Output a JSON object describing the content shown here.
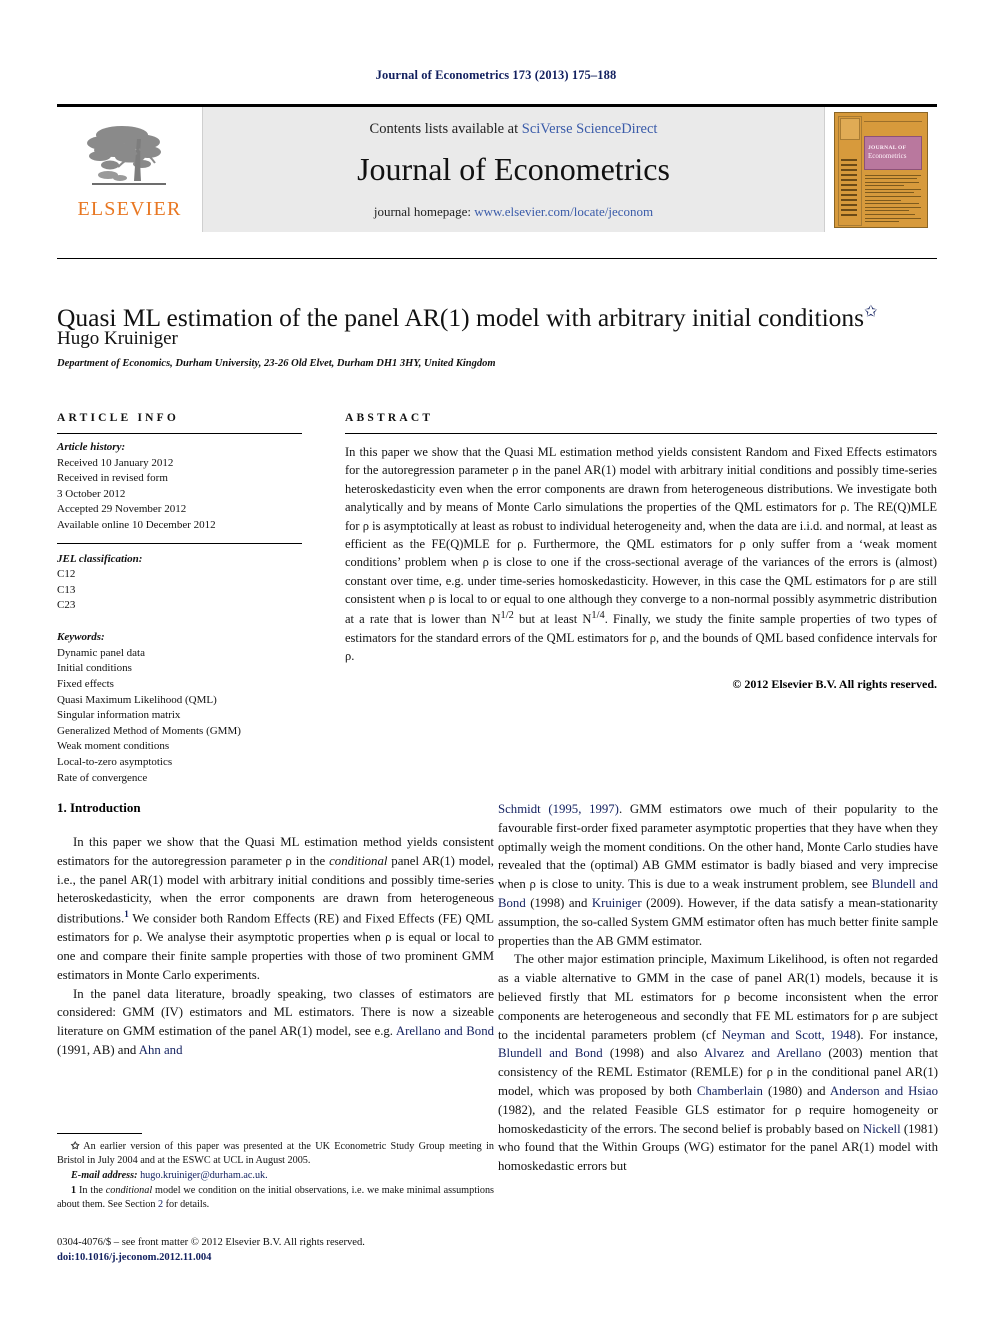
{
  "running_head": "Journal of Econometrics 173 (2013) 175–188",
  "masthead": {
    "publisher_name": "ELSEVIER",
    "contents_prefix": "Contents lists available at ",
    "contents_link": "SciVerse ScienceDirect",
    "journal_name": "Journal of Econometrics",
    "homepage_prefix": "journal homepage: ",
    "homepage_url": "www.elsevier.com/locate/jeconom",
    "cover": {
      "line1": "JOURNAL OF",
      "line2": "Econometrics"
    }
  },
  "article": {
    "title": "Quasi ML estimation of the panel AR(1) model with arbitrary initial conditions",
    "title_footnote_mark": "✩",
    "author": "Hugo Kruiniger",
    "affiliation": "Department of Economics, Durham University, 23-26 Old Elvet, Durham DH1 3HY, United Kingdom"
  },
  "info": {
    "heading": "ARTICLE INFO",
    "history_label": "Article history:",
    "history": [
      "Received 10 January 2012",
      "Received in revised form",
      "3 October 2012",
      "Accepted 29 November 2012",
      "Available online 10 December 2012"
    ],
    "jel_label": "JEL classification:",
    "jel": [
      "C12",
      "C13",
      "C23"
    ],
    "keywords_label": "Keywords:",
    "keywords": [
      "Dynamic panel data",
      "Initial conditions",
      "Fixed effects",
      "Quasi Maximum Likelihood (QML)",
      "Singular information matrix",
      "Generalized Method of Moments (GMM)",
      "Weak moment conditions",
      "Local-to-zero asymptotics",
      "Rate of convergence"
    ]
  },
  "abstract": {
    "heading": "ABSTRACT",
    "text": "In this paper we show that the Quasi ML estimation method yields consistent Random and Fixed Effects estimators for the autoregression parameter ρ in the panel AR(1) model with arbitrary initial conditions and possibly time-series heteroskedasticity even when the error components are drawn from heterogeneous distributions. We investigate both analytically and by means of Monte Carlo simulations the properties of the QML estimators for ρ. The RE(Q)MLE for ρ is asymptotically at least as robust to individual heterogeneity and, when the data are i.i.d. and normal, at least as efficient as the FE(Q)MLE for ρ. Furthermore, the QML estimators for ρ only suffer from a ‘weak moment conditions’ problem when ρ is close to one if the cross-sectional average of the variances of the errors is (almost) constant over time, e.g. under time-series homoskedasticity. However, in this case the QML estimators for ρ are still consistent when ρ is local to or equal to one although they converge to a non-normal possibly asymmetric distribution at a rate that is lower than N",
    "text_sup1": "1/2",
    "text_mid": " but at least N",
    "text_sup2": "1/4",
    "text_end": ". Finally, we study the finite sample properties of two types of estimators for the standard errors of the QML estimators for ρ, and the bounds of QML based confidence intervals for ρ.",
    "copyright": "© 2012 Elsevier B.V. All rights reserved."
  },
  "body": {
    "section_heading": "1.  Introduction",
    "left": {
      "p1_a": "In this paper we show that the Quasi ML estimation method yields consistent estimators for the autoregression parameter ρ in the ",
      "p1_ital": "conditional",
      "p1_b": " panel AR(1) model, i.e., the panel AR(1) model with arbitrary initial conditions and possibly time-series heteroskedasticity, when the error components are drawn from heterogeneous distributions.",
      "p1_fn": "1",
      "p1_c": " We consider both Random Effects (RE) and Fixed Effects (FE) QML estimators for ρ. We analyse their asymptotic properties when ρ is equal or local to one and compare their finite sample properties with those of two prominent GMM estimators in Monte Carlo experiments.",
      "p2_a": "In the panel data literature, broadly speaking, two classes of estimators are considered: GMM (IV) estimators and ML estimators. There is now a sizeable literature on GMM estimation of the panel AR(1) model, see e.g. ",
      "p2_cite1": "Arellano and Bond",
      "p2_b": " (1991, AB) and ",
      "p2_cite2": "Ahn and"
    },
    "right": {
      "p1_cite1": "Schmidt (1995, 1997)",
      "p1_a": ". GMM estimators owe much of their popularity to the favourable first-order fixed parameter asymptotic properties that they have when they optimally weigh the moment conditions. On the other hand, Monte Carlo studies have revealed that the (optimal) AB GMM estimator is badly biased and very imprecise when ρ is close to unity. This is due to a weak instrument problem, see ",
      "p1_cite2": "Blundell and Bond",
      "p1_b": " (1998) and ",
      "p1_cite3": "Kruiniger",
      "p1_c": " (2009). However, if the data satisfy a mean-stationarity assumption, the so-called System GMM estimator often has much better finite sample properties than the AB GMM estimator.",
      "p2_a": "The other major estimation principle, Maximum Likelihood, is often not regarded as a viable alternative to GMM in the case of panel AR(1) models, because it is believed firstly that ML estimators for ρ become inconsistent when the error components are heterogeneous and secondly that FE ML estimators for ρ are subject to the incidental parameters problem (cf ",
      "p2_cite1": "Neyman and Scott, 1948",
      "p2_b": "). For instance, ",
      "p2_cite2": "Blundell and Bond",
      "p2_c": " (1998) and also ",
      "p2_cite3": "Alvarez and Arellano",
      "p2_d": " (2003) mention that consistency of the REML Estimator (REMLE) for ρ in the conditional panel AR(1) model, which was proposed by both ",
      "p2_cite4": "Chamberlain",
      "p2_e": " (1980) and ",
      "p2_cite5": "Anderson and Hsiao",
      "p2_f": " (1982), and the related Feasible GLS estimator for ρ require homogeneity or homoskedasticity of the errors. The second belief is probably based on ",
      "p2_cite6": "Nickell",
      "p2_g": " (1981) who found that the Within Groups (WG) estimator for the panel AR(1) model with homoskedastic errors but"
    }
  },
  "footnotes": {
    "star_mark": "✩",
    "star_text": "An earlier version of this paper was presented at the UK Econometric Study Group meeting in Bristol in July 2004 and at the ESWC at UCL in August 2005.",
    "email_label": "E-mail address:",
    "email": "hugo.kruiniger@durham.ac.uk.",
    "one_mark": "1",
    "one_a": "In the ",
    "one_ital": "conditional",
    "one_b": " model we condition on the initial observations, i.e. we make minimal assumptions about them. See Section ",
    "one_cite": "2",
    "one_c": " for details."
  },
  "footer": {
    "issn_line": "0304-4076/$ – see front matter © 2012 Elsevier B.V. All rights reserved.",
    "doi": "doi:10.1016/j.jeconom.2012.11.004"
  },
  "colors": {
    "link_blue": "#3a5ba9",
    "cite_blue": "#12205f",
    "elsevier_orange": "#e87722",
    "masthead_gray": "#eaeaea"
  }
}
